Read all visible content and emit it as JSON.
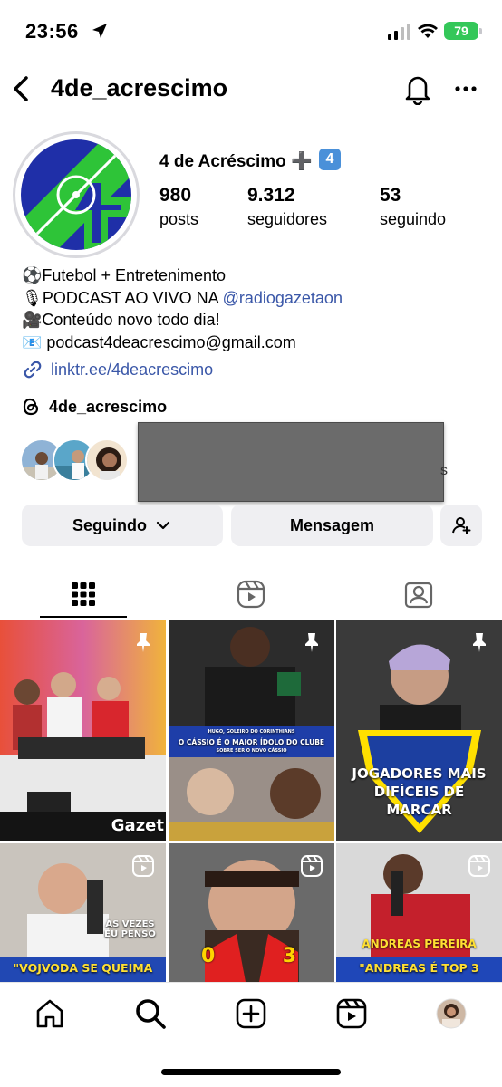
{
  "status_bar": {
    "time": "23:56",
    "battery": "79",
    "icons": [
      "location-arrow-icon",
      "signal-bars-icon",
      "wifi-icon",
      "battery-icon"
    ]
  },
  "header": {
    "username": "4de_acrescimo",
    "icons": [
      "back-chevron-icon",
      "bell-icon",
      "more-dots-icon"
    ]
  },
  "profile": {
    "display_name": "4 de Acréscimo ➕",
    "badge": "4",
    "stats": [
      {
        "number": "980",
        "label": "posts"
      },
      {
        "number": "9.312",
        "label": "seguidores"
      },
      {
        "number": "53",
        "label": "seguindo"
      }
    ],
    "bio": {
      "line1": "⚽Futebol + Entretenimento",
      "line2_text": "🎙PODCAST AO VIVO NA ",
      "line2_mention": "@radiogazetaon",
      "line3": "🎥Conteúdo novo todo dia!",
      "line4": "📧 podcast4deacrescimo@gmail.com"
    },
    "link": "linktr.ee/4deacrescimo",
    "threads_handle": "4de_acrescimo",
    "followed_by_peek": "s"
  },
  "actions": {
    "following_label": "Seguindo",
    "message_label": "Mensagem"
  },
  "tabs": [
    "grid-icon",
    "reels-icon",
    "tagged-icon"
  ],
  "grid": {
    "cells": [
      {
        "caption": "Gazet",
        "type": "pinned"
      },
      {
        "caption_small": "HUGO, GOLEIRO DO CORINTHIANS",
        "caption_main": "O CÁSSIO É O MAIOR ÍDOLO DO CLUBE",
        "caption_sub": "SOBRE SER O NOVO CÁSSIO",
        "type": "pinned"
      },
      {
        "caption": "JOGADORES MAIS DIFÍCEIS DE MARCAR",
        "type": "pinned"
      },
      {
        "caption_a": "ÀS VEZES EU PENSO",
        "caption_b": "\"VOJVODA SE QUEIMA",
        "type": "reel"
      },
      {
        "score_left": "0",
        "score_right": "3",
        "type": "reel"
      },
      {
        "caption_a": "ANDREAS PEREIRA",
        "caption_b": "\"ANDREAS É TOP 3",
        "type": "reel"
      }
    ]
  },
  "colors": {
    "link_blue": "#3a57a8",
    "button_bg": "#efeff2",
    "battery_green": "#34c759"
  }
}
